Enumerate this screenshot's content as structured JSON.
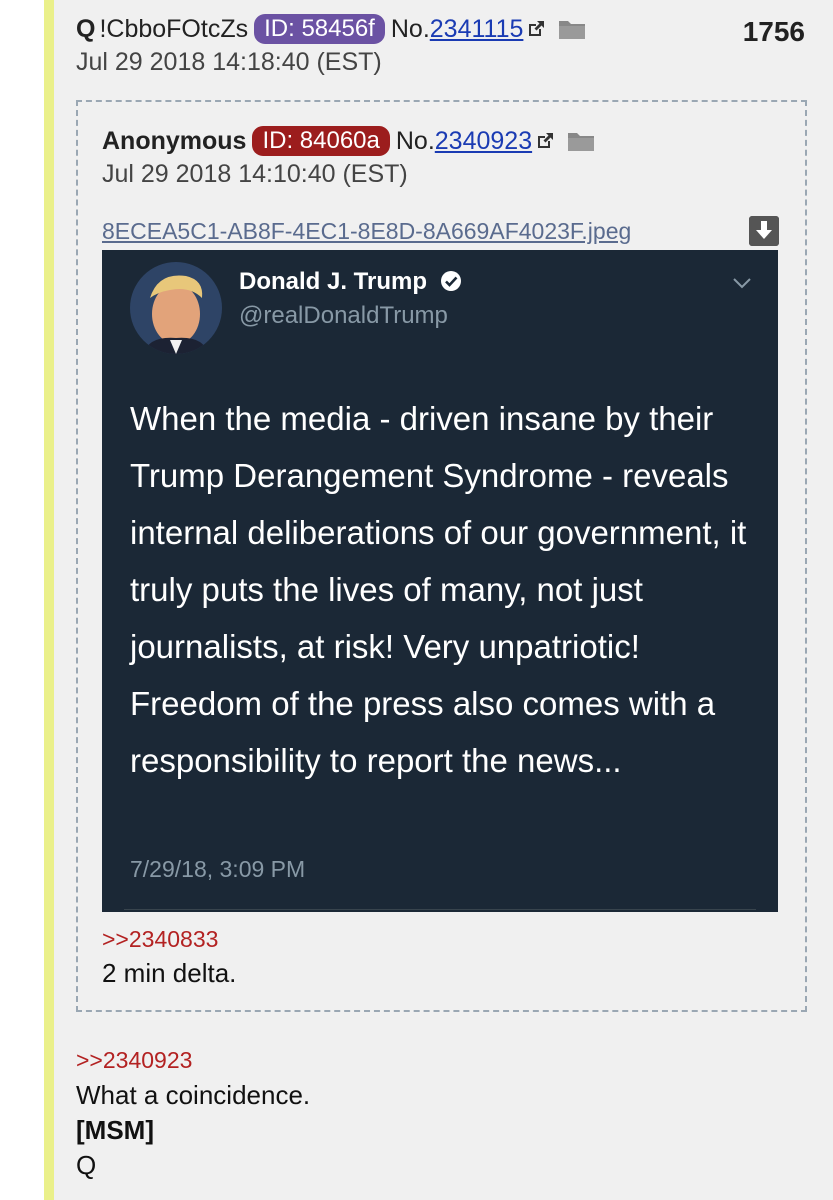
{
  "post": {
    "author": "Q",
    "tripcode": "!CbboFOtcZs",
    "id_label": "ID: 58456f",
    "id_color": "#6b52a3",
    "no_prefix": "No.",
    "post_number": "2341115",
    "date": "Jul 29 2018 14:18:40 (EST)",
    "thread_post_count": "1756",
    "body": {
      "reply_link": ">>2340923",
      "line1": "What a coincidence.",
      "line2": "[MSM]",
      "line3": "Q"
    }
  },
  "quoted_post": {
    "author": "Anonymous",
    "id_label": "ID: 84060a",
    "id_color": "#9c1d1d",
    "no_prefix": "No.",
    "post_number": "2340923",
    "date": "Jul 29 2018 14:10:40 (EST)",
    "filename": "8ECEA5C1-AB8F-4EC1-8E8D-8A669AF4023F.jpeg",
    "reply_link": ">>2340833",
    "body": "2 min delta."
  },
  "tweet": {
    "name": "Donald J. Trump",
    "handle": "@realDonaldTrump",
    "text": "When the media - driven insane by their Trump Derangement Syndrome - reveals internal deliberations of our government, it  truly puts the lives of many, not just journalists, at risk! Very unpatriotic! Freedom of the press also comes with a responsibility to report the news...",
    "timestamp": "7/29/18, 3:09 PM"
  },
  "icons": [
    "external-link-icon",
    "folder-icon",
    "download-icon",
    "verified-badge-icon",
    "chevron-down-icon"
  ]
}
